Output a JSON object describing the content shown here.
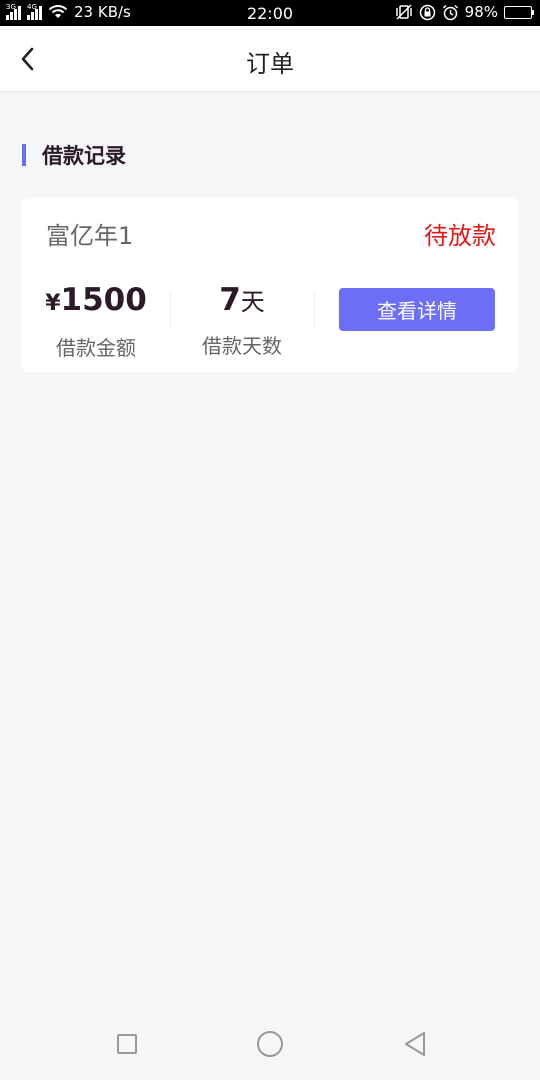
{
  "status_bar": {
    "network_left": "3G",
    "network_right": "4G",
    "speed": "23 KB/s",
    "time": "22:00",
    "battery": "98%",
    "colors": {
      "battery_fill": "#3cd43c"
    }
  },
  "nav": {
    "title": "订单",
    "back_icon": "chevron-left-icon"
  },
  "section": {
    "title": "借款记录",
    "accent_color": "#6c6ff5"
  },
  "order": {
    "product_name": "富亿年1",
    "status": "待放款",
    "status_color": "#e01919",
    "amount_symbol": "¥",
    "amount": "1500",
    "amount_label": "借款金额",
    "days": "7",
    "days_unit": "天",
    "days_label": "借款天数",
    "detail_button": "查看详情"
  },
  "system_nav": {
    "icons": [
      "recent-apps-icon",
      "home-icon",
      "back-icon"
    ]
  }
}
